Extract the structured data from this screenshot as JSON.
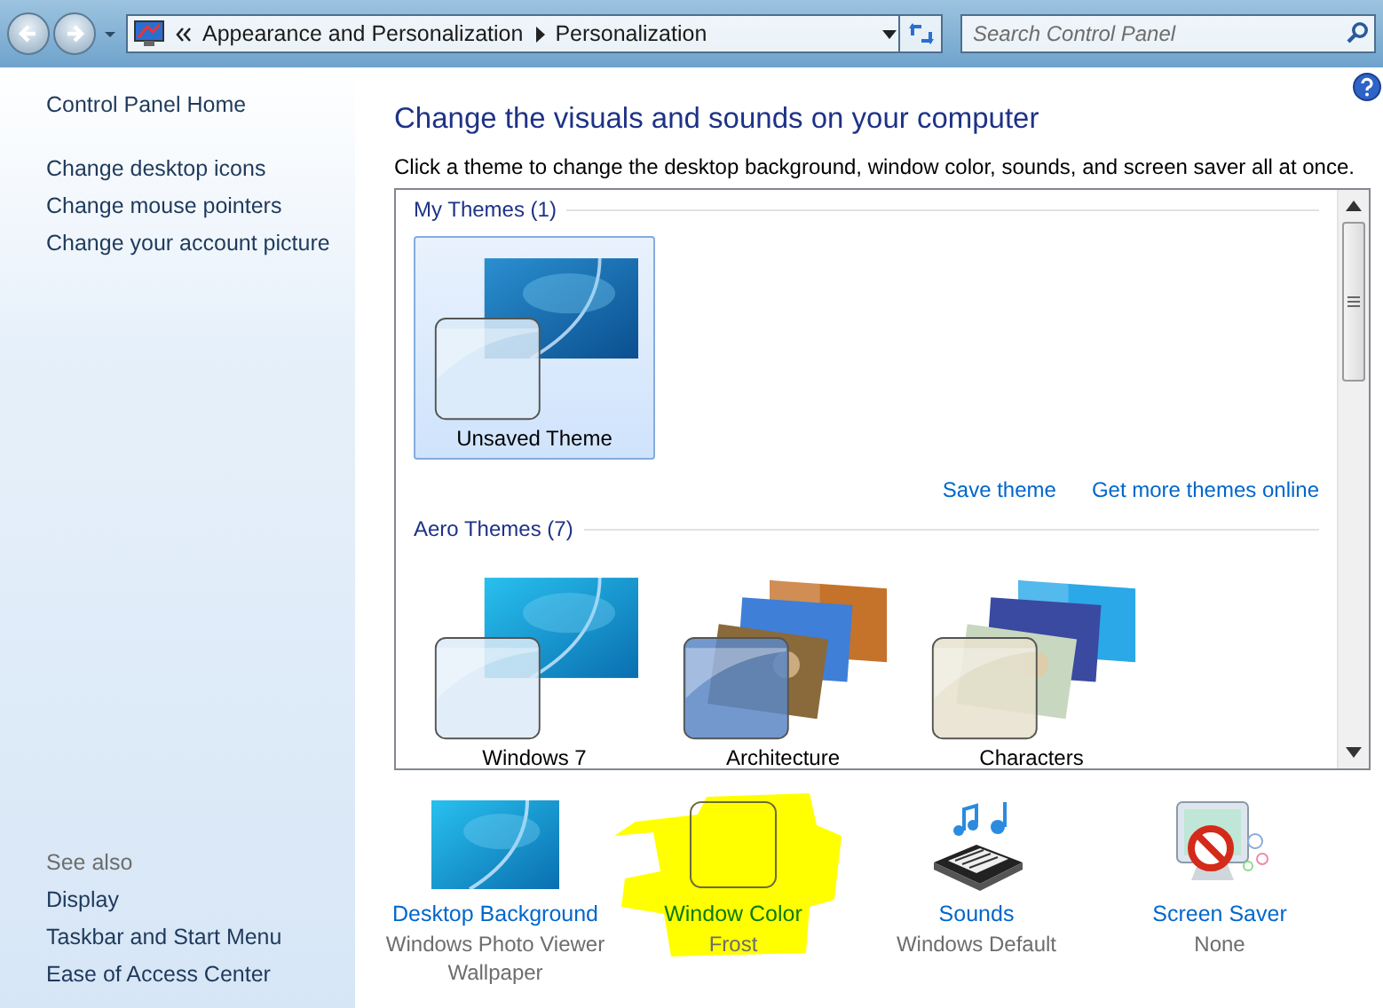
{
  "address_bar": {
    "segments": [
      "Appearance and Personalization",
      "Personalization"
    ]
  },
  "search": {
    "placeholder": "Search Control Panel"
  },
  "sidebar": {
    "home": "Control Panel Home",
    "items": [
      "Change desktop icons",
      "Change mouse pointers",
      "Change your account picture"
    ],
    "see_also": {
      "heading": "See also",
      "items": [
        "Display",
        "Taskbar and Start Menu",
        "Ease of Access Center"
      ]
    }
  },
  "title": "Change the visuals and sounds on your computer",
  "description": "Click a theme to change the desktop background, window color, sounds, and screen saver all at once.",
  "theme_groups": [
    {
      "heading": "My Themes (1)",
      "themes": [
        {
          "name": "Unsaved Theme",
          "selected": true,
          "kind": "single"
        }
      ],
      "links": [
        "Save theme",
        "Get more themes online"
      ]
    },
    {
      "heading": "Aero Themes (7)",
      "themes": [
        {
          "name": "Windows 7",
          "selected": false,
          "kind": "single"
        },
        {
          "name": "Architecture",
          "selected": false,
          "kind": "stack"
        },
        {
          "name": "Characters",
          "selected": false,
          "kind": "stack"
        }
      ]
    }
  ],
  "settings": [
    {
      "kind": "picture",
      "label": "Desktop Background",
      "value": "Windows Photo Viewer Wallpaper",
      "highlighted": false
    },
    {
      "kind": "swatch",
      "label": "Window Color",
      "value": "Frost",
      "highlighted": true
    },
    {
      "kind": "sounds",
      "label": "Sounds",
      "value": "Windows Default",
      "highlighted": false
    },
    {
      "kind": "screensaver",
      "label": "Screen Saver",
      "value": "None",
      "highlighted": false
    }
  ]
}
